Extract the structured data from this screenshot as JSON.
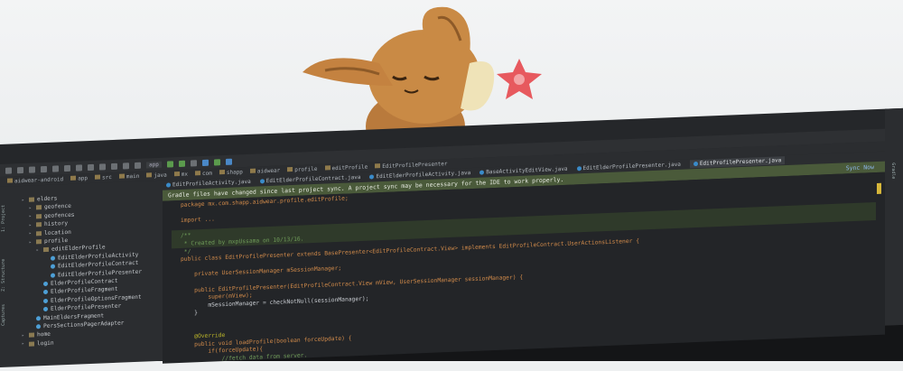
{
  "notice": {
    "text": "Gradle files have changed since last project sync. A project sync may be necessary for the IDE to work properly.",
    "action": "Sync Now"
  },
  "run_config": "app",
  "breadcrumb": [
    "aidwear-android",
    "app",
    "src",
    "main",
    "java",
    "mx",
    "com",
    "shapp",
    "aidwear",
    "profile",
    "editProfile",
    "EditProfilePresenter"
  ],
  "tabs": [
    "EditProfileActivity.java",
    "EditElderProfileContract.java",
    "EditElderProfileActivity.java",
    "BaseActivityEditView.java",
    "EditElderProfilePresenter.java",
    "EditProfilePresenter.java"
  ],
  "sidebar": {
    "project_label": "1: Project",
    "structure_label": "Z: Structure",
    "captures_label": "Captures",
    "gradle_label": "Gradle"
  },
  "tree": [
    {
      "label": "elders",
      "kind": "folder",
      "indent": 1
    },
    {
      "label": "geofence",
      "kind": "folder",
      "indent": 2
    },
    {
      "label": "geofences",
      "kind": "folder",
      "indent": 2
    },
    {
      "label": "history",
      "kind": "folder",
      "indent": 2
    },
    {
      "label": "location",
      "kind": "folder",
      "indent": 2
    },
    {
      "label": "profile",
      "kind": "folder",
      "indent": 2
    },
    {
      "label": "editElderProfile",
      "kind": "folder",
      "indent": 3
    },
    {
      "label": "EditElderProfileActivity",
      "kind": "class",
      "indent": 4
    },
    {
      "label": "EditElderProfileContract",
      "kind": "class",
      "indent": 4
    },
    {
      "label": "EditElderProfilePresenter",
      "kind": "class",
      "indent": 4
    },
    {
      "label": "ElderProfileContract",
      "kind": "class",
      "indent": 3
    },
    {
      "label": "ElderProfileFragment",
      "kind": "class",
      "indent": 3
    },
    {
      "label": "ElderProfileOptionsFragment",
      "kind": "class",
      "indent": 3
    },
    {
      "label": "ElderProfilePresenter",
      "kind": "class",
      "indent": 3
    },
    {
      "label": "MainEldersFragment",
      "kind": "class",
      "indent": 2
    },
    {
      "label": "PersSectionsPagerAdapter",
      "kind": "class",
      "indent": 2
    },
    {
      "label": "home",
      "kind": "folder",
      "indent": 1
    },
    {
      "label": "login",
      "kind": "folder",
      "indent": 1
    }
  ],
  "code": [
    "package mx.com.shapp.aidwear.profile.editProfile;",
    "",
    "import ...",
    "",
    "/**",
    " * Created by mxpUssama on 10/13/16.",
    " */",
    "public class EditProfilePresenter extends BasePresenter<EditProfileContract.View> implements EditProfileContract.UserActionsListener {",
    "",
    "    private UserSessionManager mSessionManager;",
    "",
    "    public EditProfilePresenter(EditProfileContract.View mView, UserSessionManager sessionManager) {",
    "        super(mView);",
    "        mSessionManager = checkNotNull(sessionManager);",
    "    }",
    "",
    "",
    "    @Override",
    "    public void loadProfile(boolean forceUpdate) {",
    "        if(forceUpdate){",
    "            //fetch data from server."
  ],
  "colors": {
    "ide_bg": "#25272a",
    "notice_bg": "#4a5a3a",
    "accent": "#d7b73a",
    "plush_body": "#c98a45",
    "toy_star": "#e7595e"
  }
}
